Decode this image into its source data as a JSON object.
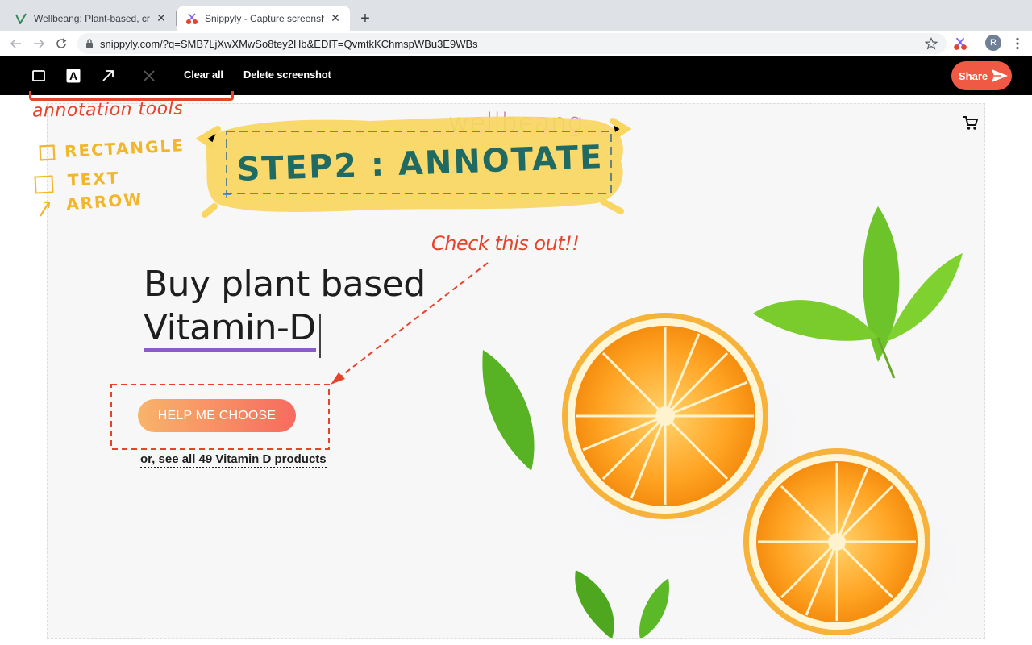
{
  "browser": {
    "tabs": [
      {
        "title": "Wellbeang: Plant-based, cruelt",
        "active": false
      },
      {
        "title": "Snippyly - Capture screenshot",
        "active": true
      }
    ],
    "url": "snippyly.com/?q=SMB7LjXwXMwSo8tey2Hb&EDIT=QvmtkKChmspWBu3E9WBs",
    "profile_initial": "R"
  },
  "editor": {
    "clear_all": "Clear all",
    "delete_screenshot": "Delete screenshot",
    "share": "Share",
    "text_tool_glyph": "A"
  },
  "annotations": {
    "tools_label": "annotation tools",
    "legend": [
      "RECTANGLE",
      "TEXT",
      "ARROW"
    ],
    "step_title": "STEP2 : ANNOTATE",
    "check_note": "Check this out!!",
    "highlight_color": "#f9d660",
    "accent_red": "#e5432b"
  },
  "site": {
    "logo": "wellbeang",
    "headline_line1": "Buy plant based",
    "headline_line2": "Vitamin-D",
    "cta": "HELP ME CHOOSE",
    "see_all": "or, see all 49 Vitamin D products"
  },
  "colors": {
    "editbar": "#000000",
    "share": "#f05a45",
    "cta_start": "#f8b46a",
    "cta_end": "#f76b5f",
    "step_text": "#1f6b64",
    "legend": "#f2b62a"
  }
}
